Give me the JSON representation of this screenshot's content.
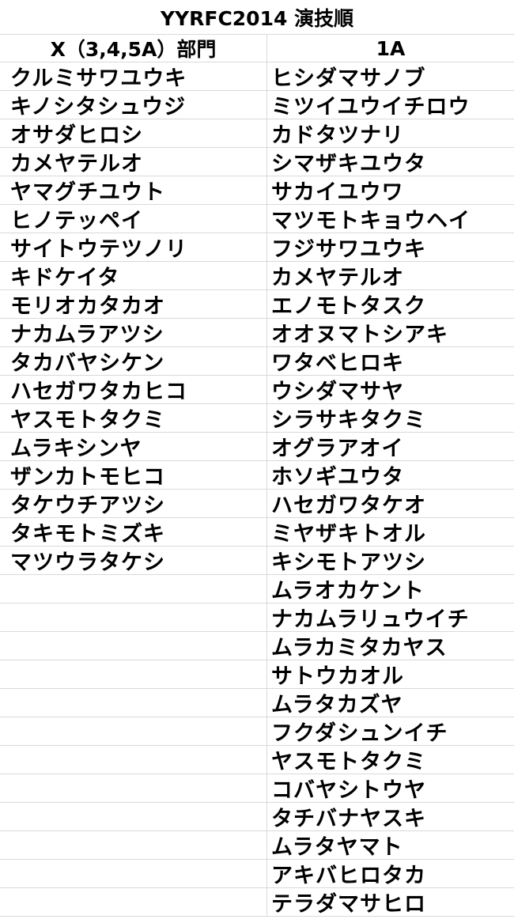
{
  "title": "YYRFC2014 演技順",
  "columns": [
    {
      "header": "X（3,4,5A）部門",
      "names": [
        "クルミサワユウキ",
        "キノシタシュウジ",
        "オサダヒロシ",
        "カメヤテルオ",
        "ヤマグチユウト",
        "ヒノテッペイ",
        "サイトウテツノリ",
        "キドケイタ",
        "モリオカタカオ",
        "ナカムラアツシ",
        "タカバヤシケン",
        "ハセガワタカヒコ",
        "ヤスモトタクミ",
        "ムラキシンヤ",
        "ザンカトモヒコ",
        "タケウチアツシ",
        "タキモトミズキ",
        "マツウラタケシ"
      ]
    },
    {
      "header": "1A",
      "names": [
        "ヒシダマサノブ",
        "ミツイユウイチロウ",
        "カドタツナリ",
        "シマザキユウタ",
        "サカイユウワ",
        "マツモトキョウヘイ",
        "フジサワユウキ",
        "カメヤテルオ",
        "エノモトタスク",
        "オオヌマトシアキ",
        "ワタベヒロキ",
        "ウシダマサヤ",
        "シラサキタクミ",
        "オグラアオイ",
        "ホソギユウタ",
        "ハセガワタケオ",
        "ミヤザキトオル",
        "キシモトアツシ",
        "ムラオカケント",
        "ナカムラリュウイチ",
        "ムラカミタカヤス",
        "サトウカオル",
        "ムラタカズヤ",
        "フクダシュンイチ",
        "ヤスモトタクミ",
        "コバヤシトウヤ",
        "タチバナヤスキ",
        "ムラタヤマト",
        "アキバヒロタカ",
        "テラダマサヒロ"
      ]
    }
  ]
}
